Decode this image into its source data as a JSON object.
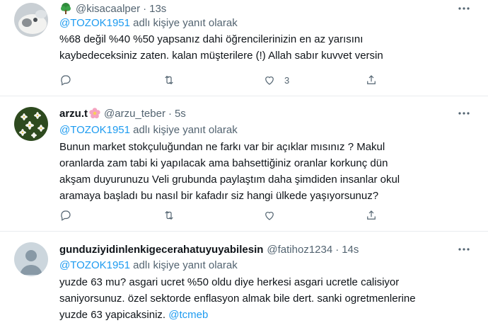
{
  "tweets": [
    {
      "name": "",
      "name_icon": "tree-icon",
      "handle": "@kisacaalper",
      "time": "13s",
      "reply_prefix": "",
      "mention": "@TOZOK1951",
      "reply_suffix": "adlı kişiye yanıt olarak",
      "text": "%68 değil %40 %50 yapsanız dahi öğrencilerinizin en az yarısını\nkaybedeceksiniz zaten. kalan müşterilere (!) Allah sabır kuvvet versin",
      "reply_count": "",
      "retweet_count": "",
      "like_count": "3"
    },
    {
      "name": "arzu.t",
      "name_icon": "flower-icon",
      "handle": "@arzu_teber",
      "time": "5s",
      "mention": "@TOZOK1951",
      "reply_suffix": "adlı kişiye yanıt olarak",
      "text": "Bunun market stokçuluğundan ne farkı var bir açıklar mısınız ? Makul\noranlarda zam tabi ki yapılacak ama bahsettiğiniz oranlar korkunç dün\nakşam duyurunuzu Veli grubunda paylaştım daha şimdiden insanlar okul\naramaya başladı bu nasıl bir kafadır siz hangi ülkede yaşıyorsunuz?",
      "reply_count": "",
      "retweet_count": "",
      "like_count": ""
    },
    {
      "name": "gunduziyidinlenkigecerahatuyuyabilesin",
      "handle": "@fatihoz1234",
      "time": "14s",
      "mention": "@TOZOK1951",
      "reply_suffix": "adlı kişiye yanıt olarak",
      "text": "yuzde 63 mu? asgari ucret %50 oldu diye herkesi asgari ucretle calisiyor\nsaniyorsunuz. özel sektorde enflasyon almak bile dert. sanki ogretmenlerine\nyuzde 63 yapicaksiniz.",
      "text_link": "@tcmeb"
    }
  ]
}
